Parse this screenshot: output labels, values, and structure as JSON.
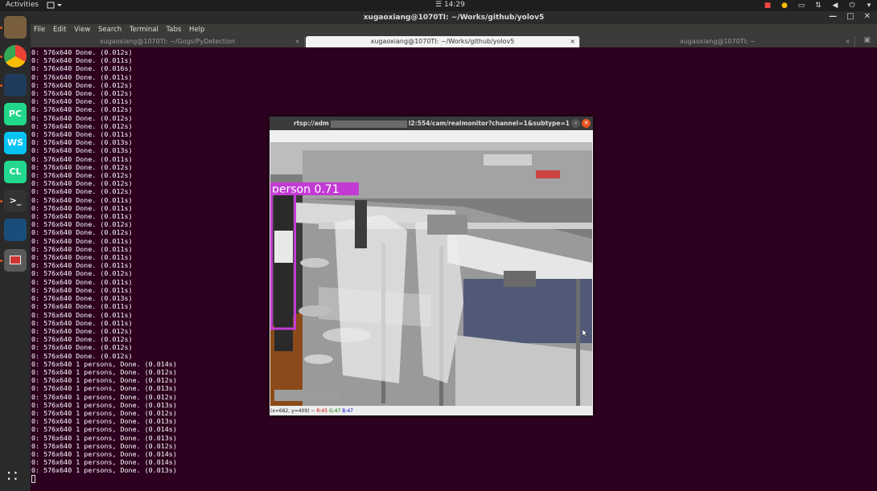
{
  "topbar": {
    "activities": "Activities",
    "clock": "14:29"
  },
  "dock": {
    "apps": [
      {
        "name": "files",
        "label": "",
        "color": "#7a5f3e"
      },
      {
        "name": "chrome",
        "label": "",
        "color": "#4285f4"
      },
      {
        "name": "screen-recorder",
        "label": "",
        "color": "#1f3a5a"
      },
      {
        "name": "pycharm",
        "label": "PC",
        "color": "#21d789"
      },
      {
        "name": "webstorm",
        "label": "WS",
        "color": "#07c3f2"
      },
      {
        "name": "clion",
        "label": "CL",
        "color": "#22d88f"
      },
      {
        "name": "terminal",
        "label": ">_",
        "color": "#333"
      },
      {
        "name": "mysql-workbench",
        "label": "",
        "color": "#1b4d7a"
      },
      {
        "name": "opencv-window",
        "label": "",
        "color": "#5a5a5a"
      }
    ],
    "apps_grid": "∷"
  },
  "window": {
    "title": "xugaoxiang@1070TI: ~/Works/github/yolov5"
  },
  "menu": [
    "File",
    "Edit",
    "View",
    "Search",
    "Terminal",
    "Tabs",
    "Help"
  ],
  "tabs": [
    {
      "label": "xugaoxiang@1070TI: ~/Gogs/PyDetection",
      "close": "×"
    },
    {
      "label": "xugaoxiang@1070TI: ~/Works/github/yolov5",
      "close": "×"
    },
    {
      "label": "xugaoxiang@1070TI: ~",
      "close": "×"
    }
  ],
  "terminal_lines": [
    "0: 576x640 Done. (0.012s)",
    "0: 576x640 Done. (0.011s)",
    "0: 576x640 Done. (0.016s)",
    "0: 576x640 Done. (0.011s)",
    "0: 576x640 Done. (0.012s)",
    "0: 576x640 Done. (0.012s)",
    "0: 576x640 Done. (0.011s)",
    "0: 576x640 Done. (0.012s)",
    "0: 576x640 Done. (0.012s)",
    "0: 576x640 Done. (0.012s)",
    "0: 576x640 Done. (0.011s)",
    "0: 576x640 Done. (0.013s)",
    "0: 576x640 Done. (0.013s)",
    "0: 576x640 Done. (0.011s)",
    "0: 576x640 Done. (0.012s)",
    "0: 576x640 Done. (0.012s)",
    "0: 576x640 Done. (0.012s)",
    "0: 576x640 Done. (0.012s)",
    "0: 576x640 Done. (0.011s)",
    "0: 576x640 Done. (0.011s)",
    "0: 576x640 Done. (0.011s)",
    "0: 576x640 Done. (0.012s)",
    "0: 576x640 Done. (0.012s)",
    "0: 576x640 Done. (0.011s)",
    "0: 576x640 Done. (0.011s)",
    "0: 576x640 Done. (0.011s)",
    "0: 576x640 Done. (0.011s)",
    "0: 576x640 Done. (0.012s)",
    "0: 576x640 Done. (0.011s)",
    "0: 576x640 Done. (0.011s)",
    "0: 576x640 Done. (0.013s)",
    "0: 576x640 Done. (0.011s)",
    "0: 576x640 Done. (0.011s)",
    "0: 576x640 Done. (0.011s)",
    "0: 576x640 Done. (0.012s)",
    "0: 576x640 Done. (0.012s)",
    "0: 576x640 Done. (0.012s)",
    "0: 576x640 Done. (0.012s)",
    "0: 576x640 1 persons, Done. (0.014s)",
    "0: 576x640 1 persons, Done. (0.012s)",
    "0: 576x640 1 persons, Done. (0.012s)",
    "0: 576x640 1 persons, Done. (0.013s)",
    "0: 576x640 1 persons, Done. (0.012s)",
    "0: 576x640 1 persons, Done. (0.013s)",
    "0: 576x640 1 persons, Done. (0.012s)",
    "0: 576x640 1 persons, Done. (0.013s)",
    "0: 576x640 1 persons, Done. (0.014s)",
    "0: 576x640 1 persons, Done. (0.013s)",
    "0: 576x640 1 persons, Done. (0.012s)",
    "0: 576x640 1 persons, Done. (0.014s)",
    "0: 576x640 1 persons, Done. (0.014s)",
    "0: 576x640 1 persons, Done. (0.013s)"
  ],
  "cv_window": {
    "title_left": "rtsp://adm",
    "title_right": "l2:554/cam/realmonitor?channel=1&subtype=1",
    "detection_label": "person  0.71",
    "status_prefix": "(x=682, y=409) ~ ",
    "status_r": "R:45",
    "status_g": "G:47",
    "status_b": "B:47",
    "box_color": "#c23bd4"
  }
}
